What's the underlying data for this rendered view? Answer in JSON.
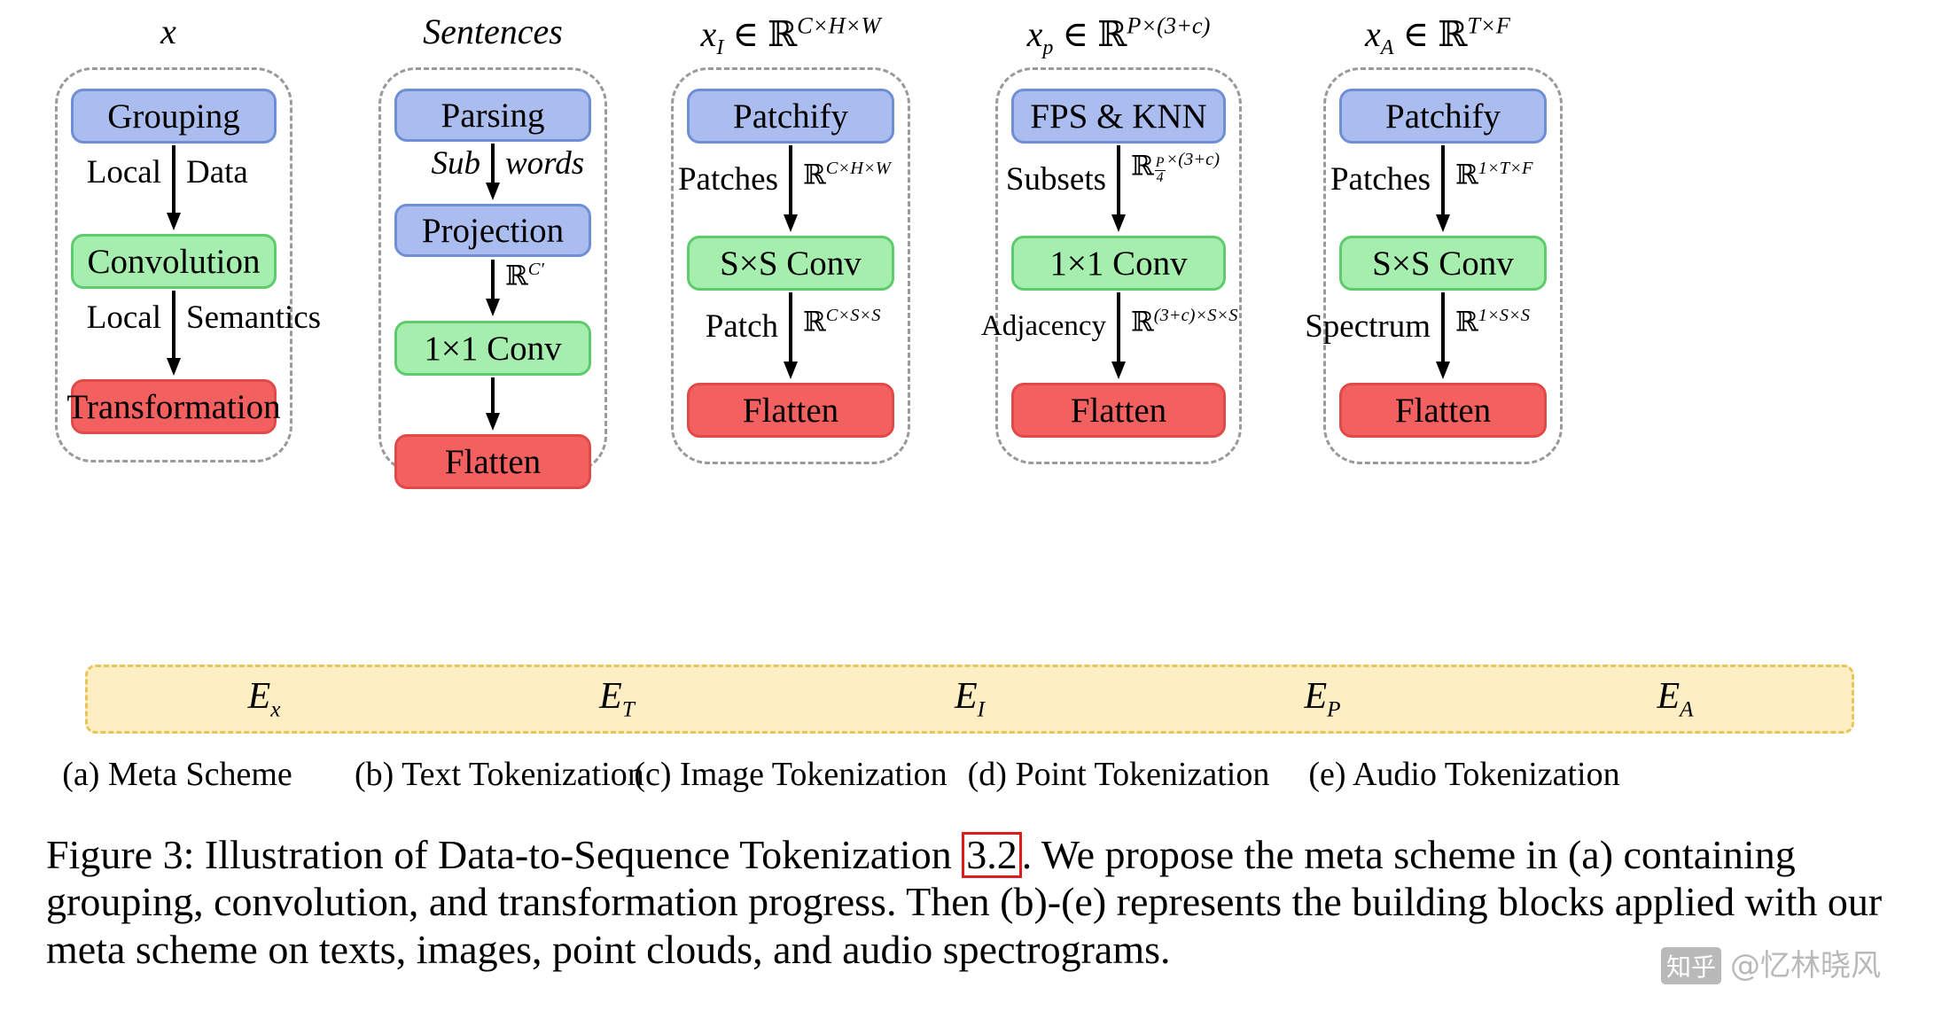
{
  "figure": {
    "caption_pre": "Figure 3: Illustration of Data-to-Sequence Tokenization ",
    "caption_ref": "3.2",
    "caption_post": ". We propose the meta scheme in (a) containing grouping, convolution, and transformation progress. Then (b)-(e) represents the building blocks applied with our meta scheme on texts, images, point clouds, and audio spectrograms.",
    "ref_box_color": "#e01b1b"
  },
  "colors": {
    "blue_fill": "#aabdee",
    "blue_stroke": "#6f8fd4",
    "green_fill": "#a5eeae",
    "green_stroke": "#5ecb6e",
    "red_fill": "#f2605f",
    "red_stroke": "#e04a49",
    "dash_gray": "#9a9a9a",
    "ebar_fill": "#fdeec3",
    "ebar_stroke": "#e8c55b"
  },
  "panels": [
    {
      "id": "meta-scheme",
      "heading": "x",
      "heading_italic": true,
      "nodes": [
        {
          "label": "Grouping",
          "color": "blue"
        },
        {
          "label": "Convolution",
          "color": "green"
        },
        {
          "label": "Transformation",
          "color": "red"
        }
      ],
      "connectors": [
        {
          "left": "Local",
          "right": "Data",
          "italic": false
        },
        {
          "left": "Local",
          "right": "Semantics",
          "italic": false
        }
      ],
      "subcaption": "(a) Meta Scheme",
      "ebar": {
        "base": "E",
        "sub": "x"
      }
    },
    {
      "id": "text-tokenization",
      "heading": "Sentences",
      "heading_italic": true,
      "nodes": [
        {
          "label": "Parsing",
          "color": "blue"
        },
        {
          "label": "Projection",
          "color": "blue"
        },
        {
          "label": "1×1 Conv",
          "color": "green"
        },
        {
          "label": "Flatten",
          "color": "red"
        }
      ],
      "connectors": [
        {
          "left": "Sub",
          "right": "words",
          "italic": true
        },
        {
          "left": "",
          "right": "ℝ^{C'}",
          "italic": false
        },
        {
          "left": "",
          "right": "",
          "italic": false
        }
      ],
      "subcaption": "(b) Text Tokenization",
      "ebar": {
        "base": "E",
        "sub": "T"
      }
    },
    {
      "id": "image-tokenization",
      "heading": "x_I ∈ ℝ^{C×H×W}",
      "heading_italic": true,
      "nodes": [
        {
          "label": "Patchify",
          "color": "blue"
        },
        {
          "label": "S×S Conv",
          "color": "green"
        },
        {
          "label": "Flatten",
          "color": "red"
        }
      ],
      "connectors": [
        {
          "left": "Patches",
          "right": "ℝ^{C×H×W}",
          "italic": false
        },
        {
          "left": "Patch",
          "right": "ℝ^{C×S×S}",
          "italic": false
        }
      ],
      "subcaption": "(c) Image Tokenization",
      "ebar": {
        "base": "E",
        "sub": "I"
      }
    },
    {
      "id": "point-tokenization",
      "heading": "x_p ∈ ℝ^{P×(3+c)}",
      "heading_italic": true,
      "nodes": [
        {
          "label": "FPS & KNN",
          "color": "blue"
        },
        {
          "label": "1×1 Conv",
          "color": "green"
        },
        {
          "label": "Flatten",
          "color": "red"
        }
      ],
      "connectors": [
        {
          "left": "Subsets",
          "right": "ℝ^{(P/4)×(3+c)}",
          "italic": false
        },
        {
          "left": "Adjacency",
          "right": "ℝ^{(3+c)×S×S}",
          "italic": false
        }
      ],
      "subcaption": "(d) Point Tokenization",
      "ebar": {
        "base": "E",
        "sub": "P"
      }
    },
    {
      "id": "audio-tokenization",
      "heading": "x_A ∈ ℝ^{T×F}",
      "heading_italic": true,
      "nodes": [
        {
          "label": "Patchify",
          "color": "blue"
        },
        {
          "label": "S×S Conv",
          "color": "green"
        },
        {
          "label": "Flatten",
          "color": "red"
        }
      ],
      "connectors": [
        {
          "left": "Patches",
          "right": "ℝ^{1×T×F}",
          "italic": false
        },
        {
          "left": "Spectrum",
          "right": "ℝ^{1×S×S}",
          "italic": false
        }
      ],
      "subcaption": "(e) Audio Tokenization",
      "ebar": {
        "base": "E",
        "sub": "A"
      }
    }
  ],
  "labels": {
    "p_a_node_0": "Grouping",
    "p_a_node_1": "Convolution",
    "p_a_node_2": "Transformation",
    "p_a_conn_0_l": "Local",
    "p_a_conn_0_r": "Data",
    "p_a_conn_1_l": "Local",
    "p_a_conn_1_r": "Semantics",
    "p_b_node_0": "Parsing",
    "p_b_node_1": "Projection",
    "p_b_node_2": "1×1 Conv",
    "p_b_node_3": "Flatten",
    "p_b_conn_0_l": "Sub",
    "p_b_conn_0_r": "words",
    "p_c_node_0": "Patchify",
    "p_c_node_1": "S×S Conv",
    "p_c_node_2": "Flatten",
    "p_c_conn_0_l": "Patches",
    "p_c_conn_1_l": "Patch",
    "p_d_node_0": "FPS & KNN",
    "p_d_node_1": "1×1 Conv",
    "p_d_node_2": "Flatten",
    "p_d_conn_0_l": "Subsets",
    "p_d_conn_1_l": "Adjacency",
    "p_e_node_0": "Patchify",
    "p_e_node_1": "S×S Conv",
    "p_e_node_2": "Flatten",
    "p_e_conn_0_l": "Patches",
    "p_e_conn_1_l": "Spectrum",
    "subcap_a": "(a) Meta Scheme",
    "subcap_b": "(b) Text Tokenization",
    "subcap_c": "(c) Image Tokenization",
    "subcap_d": "(d) Point Tokenization",
    "subcap_e": "(e) Audio Tokenization"
  },
  "watermark": {
    "logo": "知乎",
    "text": "@忆林晓风"
  }
}
